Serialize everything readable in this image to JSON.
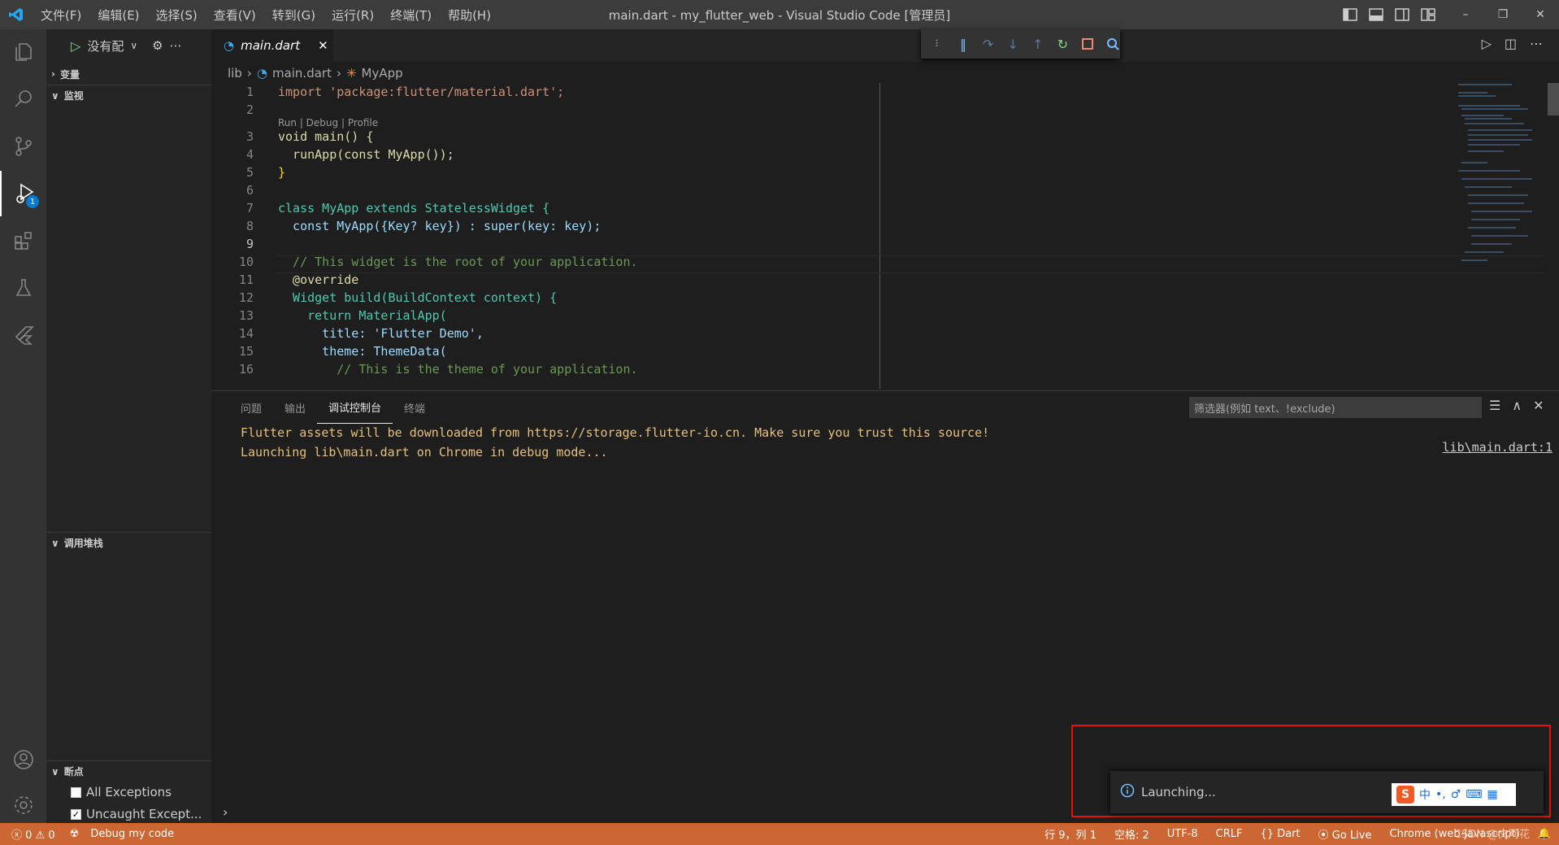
{
  "window": {
    "title": "main.dart - my_flutter_web - Visual Studio Code [管理员]",
    "menu": [
      "文件(F)",
      "编辑(E)",
      "选择(S)",
      "查看(V)",
      "转到(G)",
      "运行(R)",
      "终端(T)",
      "帮助(H)"
    ]
  },
  "activity": {
    "debug_badge": "1"
  },
  "sidebar": {
    "run_config": "没有配",
    "sections": {
      "variables": "变量",
      "watch": "监视",
      "callstack": "调用堆栈",
      "breakpoints": "断点"
    },
    "breakpoints": [
      "All Exceptions",
      "Uncaught Except..."
    ]
  },
  "tab": {
    "label": "main.dart"
  },
  "breadcrumb": {
    "folder": "lib",
    "file": "main.dart",
    "symbol": "MyApp"
  },
  "editor": {
    "codelens": "Run | Debug | Profile",
    "line_numbers": [
      "1",
      "2",
      "3",
      "4",
      "5",
      "6",
      "7",
      "8",
      "9",
      "10",
      "11",
      "12",
      "13",
      "14",
      "15",
      "16"
    ],
    "lines": [
      "import 'package:flutter/material.dart';",
      "",
      "void main() {",
      "  runApp(const MyApp());",
      "}",
      "",
      "class MyApp extends StatelessWidget {",
      "  const MyApp({Key? key}) : super(key: key);",
      "",
      "  // This widget is the root of your application.",
      "  @override",
      "  Widget build(BuildContext context) {",
      "    return MaterialApp(",
      "      title: 'Flutter Demo',",
      "      theme: ThemeData(",
      "        // This is the theme of your application."
    ]
  },
  "panel": {
    "tabs": [
      "问题",
      "输出",
      "调试控制台",
      "终端"
    ],
    "filter_placeholder": "筛选器(例如 text、!exclude)",
    "output": [
      "Flutter assets will be downloaded from https://storage.flutter-io.cn. Make sure you trust this source!",
      "Launching lib\\main.dart on Chrome in debug mode..."
    ],
    "source_link": "lib\\main.dart:1"
  },
  "notification": {
    "text": "Launching..."
  },
  "ime": {
    "lang": "中",
    "punct": "•,"
  },
  "statusbar": {
    "errors": "0",
    "warnings": "0",
    "debug": "Debug my code",
    "position": "行 9，列 1",
    "spaces": "空格: 2",
    "encoding": "UTF-8",
    "eol": "CRLF",
    "language": "Dart",
    "golive": "Go Live",
    "device": "Chrome (web-javascript)"
  },
  "watermark": "CSDN @文阿花",
  "colors": {
    "statusbar": "#cc6633",
    "accent": "#007acc",
    "output": "#e5c07b"
  }
}
